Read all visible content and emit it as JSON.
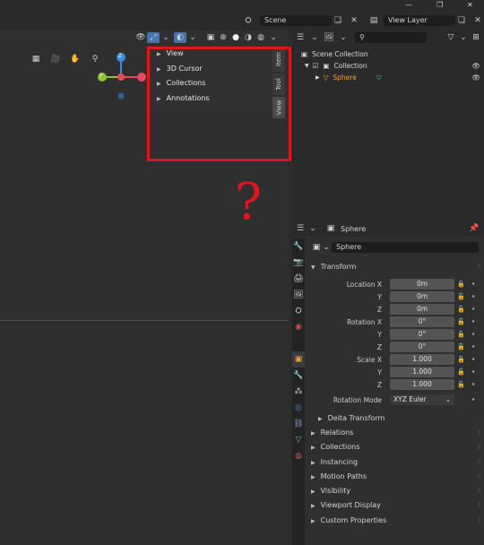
{
  "window": {
    "min": "—",
    "restore": "❐",
    "close": "✕"
  },
  "topbar": {
    "scene_label": "Scene",
    "viewlayer_label": "View Layer"
  },
  "viewport": {
    "npanel_items": [
      "View",
      "3D Cursor",
      "Collections",
      "Annotations"
    ],
    "tabs": [
      "Item",
      "Tool",
      "View"
    ],
    "gizmo": {
      "z": "Z",
      "y": "Y",
      "x": "X"
    },
    "question_mark": "?"
  },
  "outliner": {
    "search_placeholder": "",
    "scene_collection": "Scene Collection",
    "collection": "Collection",
    "object": "Sphere"
  },
  "properties": {
    "header_name": "Sphere",
    "object_name": "Sphere",
    "transform_label": "Transform",
    "location": {
      "label": "Location X",
      "x": "0m",
      "y": "0m",
      "z": "0m"
    },
    "rotation": {
      "label": "Rotation X",
      "x": "0°",
      "y": "0°",
      "z": "0°"
    },
    "scale": {
      "label": "Scale X",
      "x": "1.000",
      "y": "1.000",
      "z": "1.000"
    },
    "axis_y": "Y",
    "axis_z": "Z",
    "rotation_mode_label": "Rotation Mode",
    "rotation_mode_value": "XYZ Euler",
    "delta_transform": "Delta Transform",
    "sections": [
      "Relations",
      "Collections",
      "Instancing",
      "Motion Paths",
      "Visibility",
      "Viewport Display",
      "Custom Properties"
    ]
  },
  "colors": {
    "accent_orange": "#f0a030",
    "highlight_red": "#e0161d",
    "gizmo_x": "#e84a5f",
    "gizmo_y": "#8ec52e",
    "gizmo_z": "#3b8ee6"
  }
}
